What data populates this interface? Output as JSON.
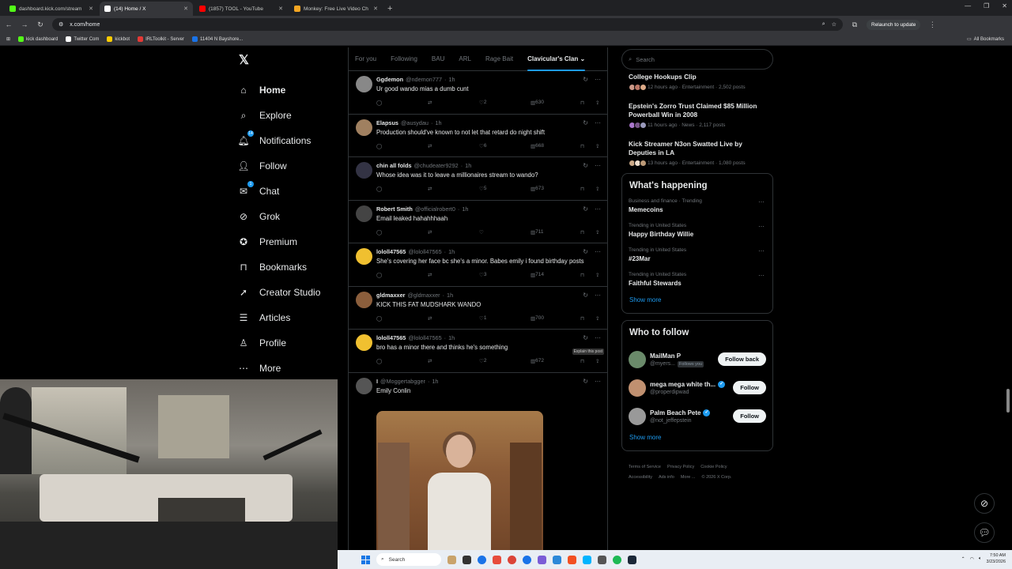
{
  "browser": {
    "tabs": [
      {
        "label": "dashboard.kick.com/stream",
        "color": "#53fc18"
      },
      {
        "label": "(14) Home / X",
        "color": "#ffffff"
      },
      {
        "label": "(1857) TOOL - YouTube",
        "color": "#ff0000"
      },
      {
        "label": "Monkey: Free Live Video Ch",
        "color": "#f5a623"
      }
    ],
    "url": "x.com/home",
    "relaunch": "Relaunch to update",
    "bookmarks": [
      {
        "label": "kick dashboard",
        "color": "#53fc18"
      },
      {
        "label": "Twitter Com",
        "color": "#ffffff"
      },
      {
        "label": "kickbot",
        "color": "#ffcc00"
      },
      {
        "label": "IRLToolkit - Server",
        "color": "#e53935"
      },
      {
        "label": "11404 N Bayshore...",
        "color": "#1a73e8"
      }
    ],
    "all_bookmarks": "All Bookmarks"
  },
  "nav": {
    "items": [
      {
        "label": "Home",
        "icon": "home-icon"
      },
      {
        "label": "Explore",
        "icon": "search-icon"
      },
      {
        "label": "Notifications",
        "icon": "bell-icon",
        "badge": "14"
      },
      {
        "label": "Follow",
        "icon": "person-add-icon"
      },
      {
        "label": "Chat",
        "icon": "mail-icon",
        "badge": "1"
      },
      {
        "label": "Grok",
        "icon": "grok-icon"
      },
      {
        "label": "Premium",
        "icon": "premium-icon"
      },
      {
        "label": "Bookmarks",
        "icon": "bookmark-icon"
      },
      {
        "label": "Creator Studio",
        "icon": "rocket-icon"
      },
      {
        "label": "Articles",
        "icon": "article-icon"
      },
      {
        "label": "Profile",
        "icon": "person-icon"
      },
      {
        "label": "More",
        "icon": "more-circle-icon"
      }
    ]
  },
  "feed": {
    "tabs": [
      "For you",
      "Following",
      "BAU",
      "ARL",
      "Rage Bait",
      "Clavicular's Clan"
    ],
    "posts": [
      {
        "name": "Ggdemon",
        "handle": "@ndemon777",
        "time": "1h",
        "text": "Ur good wando mias a dumb cunt",
        "replies": "",
        "likes": "2",
        "views": "630",
        "avatar": "#888888"
      },
      {
        "name": "Elapsus",
        "handle": "@ausydau",
        "time": "1h",
        "text": "Production should've known to not let that retard do night shift",
        "replies": "",
        "likes": "6",
        "views": "668",
        "avatar": "#a08060"
      },
      {
        "name": "chin all folds",
        "handle": "@chudeater9292",
        "time": "1h",
        "text": "Whose idea was it to leave a millionaires stream to wando?",
        "replies": "",
        "likes": "5",
        "views": "673",
        "avatar": "#333344"
      },
      {
        "name": "Robert Smith",
        "handle": "@officialrobert0",
        "time": "1h",
        "text": "Email leaked hahahhhaah",
        "replies": "",
        "likes": "",
        "views": "711",
        "avatar": "#444444"
      },
      {
        "name": "lololl47565",
        "handle": "@lololl47565",
        "time": "1h",
        "text": "She's covering her face bc she's a minor. Babes emily i found birthday posts",
        "replies": "",
        "likes": "3",
        "views": "714",
        "avatar": "#f0c030"
      },
      {
        "name": "gldmaxxer",
        "handle": "@gldmaxxer",
        "time": "1h",
        "text": "KICK THIS FAT MUDSHARK WANDO",
        "replies": "",
        "likes": "1",
        "views": "700",
        "avatar": "#8b5e3c"
      },
      {
        "name": "lololl47565",
        "handle": "@lololl47565",
        "time": "1h",
        "text": "bro has a minor there and thinks he's something",
        "replies": "",
        "likes": "2",
        "views": "672",
        "avatar": "#f0c030"
      }
    ],
    "tooltip": "Explain this post",
    "last_post": {
      "name": "I",
      "handle": "@Moggertabgger",
      "time": "1h",
      "text": "Emily Conlin"
    }
  },
  "right": {
    "search_placeholder": "Search",
    "news": [
      {
        "title": "College Hookups Clip",
        "meta": "12 hours ago · Entertainment · 2,502 posts"
      },
      {
        "title": "Epstein's Zorro Trust Claimed $85 Million Powerball Win in 2008",
        "meta": "11 hours ago · News · 2,117 posts"
      },
      {
        "title": "Kick Streamer N3on Swatted Live by Deputies in LA",
        "meta": "13 hours ago · Entertainment · 1,080 posts"
      }
    ],
    "happening_title": "What's happening",
    "trends": [
      {
        "context": "Business and finance · Trending",
        "name": "Memecoins"
      },
      {
        "context": "Trending in United States",
        "name": "Happy Birthday Willie"
      },
      {
        "context": "Trending in United States",
        "name": "#23Mar"
      },
      {
        "context": "Trending in United States",
        "name": "Faithful Stewards"
      }
    ],
    "show_more": "Show more",
    "wtf_title": "Who to follow",
    "wtf": [
      {
        "name": "MailMan P",
        "handle": "@myers...",
        "follows_you": "Follows you",
        "button": "Follow back",
        "verified": false,
        "avatar": "#6a8a6a"
      },
      {
        "name": "mega mega white th...",
        "handle": "@properdipwad",
        "button": "Follow",
        "verified": true,
        "avatar": "#c09070"
      },
      {
        "name": "Palm Beach Pete",
        "handle": "@not_jeffepstein",
        "button": "Follow",
        "verified": true,
        "avatar": "#999999"
      }
    ],
    "footer": [
      "Terms of Service",
      "Privacy Policy",
      "Cookie Policy",
      "Accessibility",
      "Ads info",
      "More ...",
      "© 2026 X Corp."
    ]
  },
  "taskbar": {
    "search": "Search",
    "time": "7:50 AM",
    "date": "3/23/2026"
  }
}
